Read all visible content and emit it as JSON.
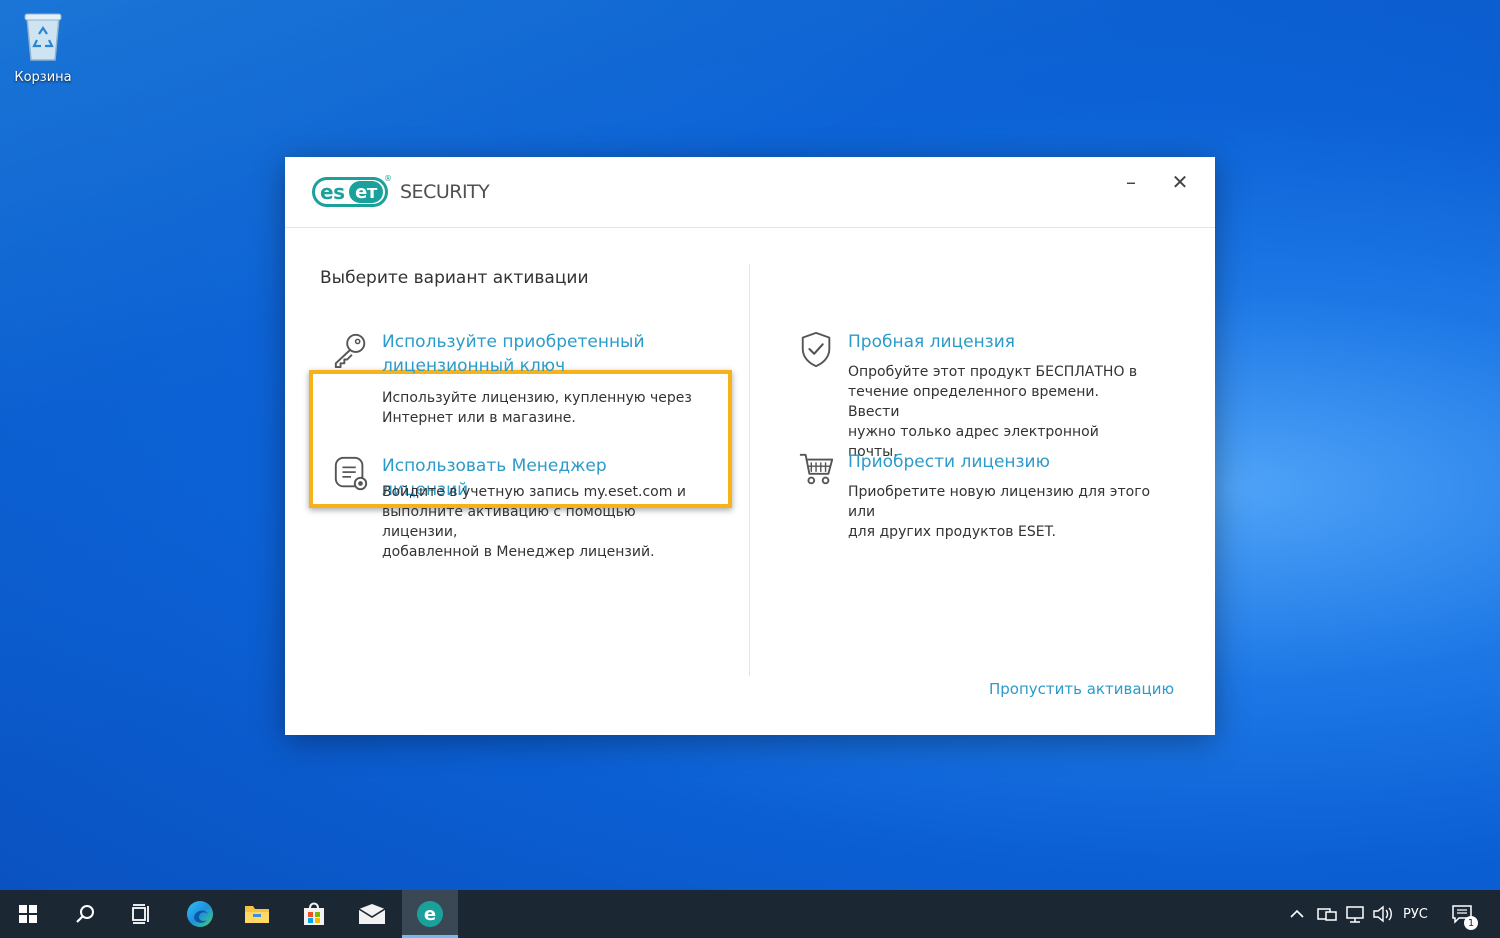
{
  "desktop": {
    "recycle_bin_label": "Корзина"
  },
  "window": {
    "logo_badge_left": "es",
    "logo_badge_right": "eт",
    "logo_reg": "®",
    "logo_text": "SECURITY",
    "minimize_glyph": "–",
    "close_glyph": "✕",
    "heading": "Выберите вариант активации",
    "options": {
      "license_key": {
        "title_line1": "Используйте приобретенный",
        "title_line2": "лицензионный ключ",
        "desc_line1": "Используйте лицензию, купленную через",
        "desc_line2": "Интернет или в магазине."
      },
      "license_manager": {
        "title": "Использовать Менеджер лицензий",
        "desc_line1": "Войдите в учетную запись my.eset.com и",
        "desc_line2": "выполните активацию с помощью лицензии,",
        "desc_line3": "добавленной в Менеджер лицензий."
      },
      "trial": {
        "title": "Пробная лицензия",
        "desc_line1": "Опробуйте этот продукт БЕСПЛАТНО в",
        "desc_line2": "течение определенного времени. Ввести",
        "desc_line3": "нужно только адрес электронной почты."
      },
      "buy": {
        "title": "Приобрести лицензию",
        "desc_line1": "Приобретите новую лицензию для этого или",
        "desc_line2": "для других продуктов ESET."
      }
    },
    "skip_link": "Пропустить активацию"
  },
  "taskbar": {
    "language": "РУС",
    "notification_count": "1",
    "eset_glyph": "e"
  },
  "colors": {
    "accent_link": "#2b9bc9",
    "eset_teal": "#1aa19b",
    "highlight": "#f5b21a",
    "taskbar": "#1b2833"
  }
}
